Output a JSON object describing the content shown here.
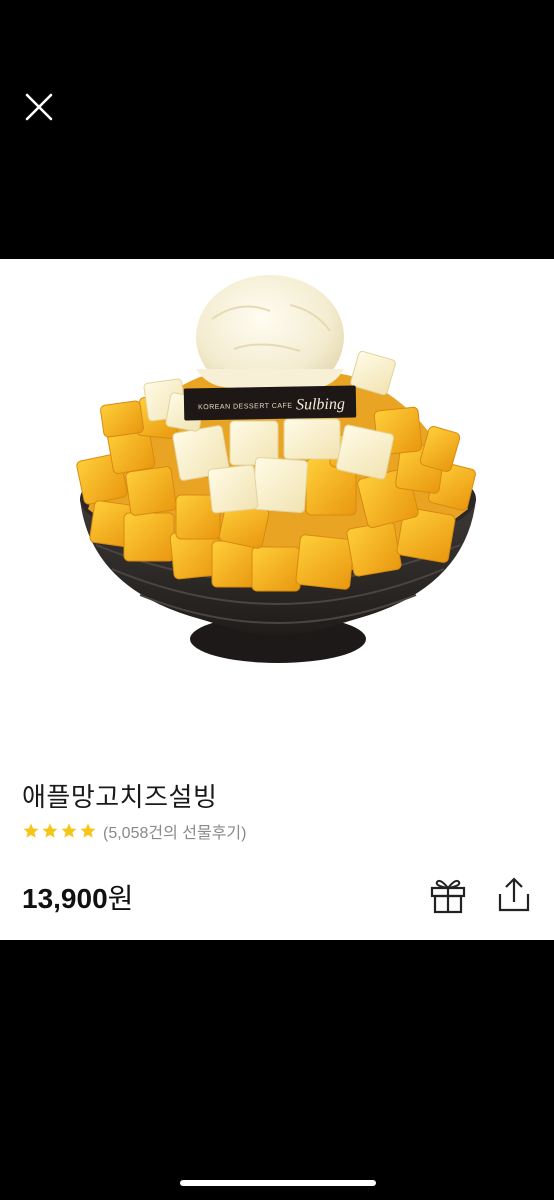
{
  "viewer": {
    "close_icon": "close-icon"
  },
  "product": {
    "image_icon": "bingsu-dessert-photo",
    "brand_plate_small": "KOREAN DESSERT CAFE",
    "brand_plate_script": "Sulbing",
    "name": "애플망고치즈설빙",
    "rating_stars": 4,
    "rating_text": "(5,058건의 선물후기)",
    "price_number": "13,900",
    "price_unit": "원"
  },
  "actions": {
    "gift_icon": "gift-icon",
    "share_icon": "share-icon"
  },
  "colors": {
    "background": "#000000",
    "card": "#ffffff",
    "star": "#f5c518",
    "mango": "#f2a81d",
    "bowl": "#2e2a28"
  }
}
